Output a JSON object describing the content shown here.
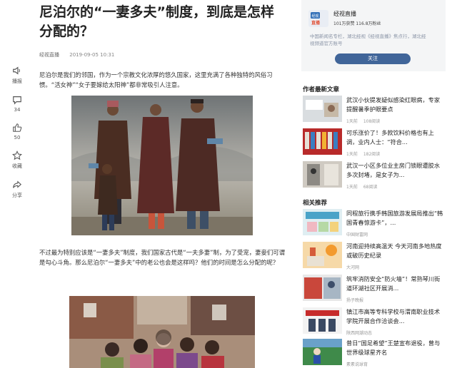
{
  "article": {
    "title": "尼泊尔的“一妻多夫”制度，到底是怎样分配的？",
    "source": "经视直播",
    "date": "2019-09-05 10:31",
    "paragraph1": "尼泊尔是我们的邻国，作为一个宗教文化浓厚的悠久国家，这里充满了各种独特的风俗习惯。“活女神”“女子要嫁给太阳神”都非常吸引人注意。",
    "paragraph2": "不过最为特别应该是“一妻多夫”制度，我们国家古代是“一夫多妻”制，为了受宠，妻妾们可谓是勾心斗角。那么尼泊尔“一妻多夫”中的老公也会是这样吗？他们的时间是怎么分配的呢？"
  },
  "rail": [
    {
      "label": "播报",
      "icon": "speaker-icon"
    },
    {
      "label": "34",
      "icon": "comment-icon"
    },
    {
      "label": "50",
      "icon": "thumbs-up-icon"
    },
    {
      "label": "收藏",
      "icon": "star-icon"
    },
    {
      "label": "分享",
      "icon": "share-icon"
    }
  ],
  "author": {
    "logo_text": "经视直播",
    "name": "经视直播",
    "stats": "101万获赞 116.8万粉丝",
    "desc": "中国新闻名专栏，湖北经视《经视直播》焦点行，湖北经视频道官方账号",
    "follow": "关注"
  },
  "author_articles": {
    "title": "作者最新文章",
    "items": [
      {
        "title": "武汉小伙提发疑似感染红眼病，专家提醒暑季护眼要点",
        "time": "1天前",
        "reads": "108阅读"
      },
      {
        "title": "可乐涨价了！多款饮料价格也有上调，业内人士：“符合...",
        "time": "1天前",
        "reads": "182阅读"
      },
      {
        "title": "武汉一小区多位业主房门锁眼遭胶水多次封堵，是女子为...",
        "time": "1天前",
        "reads": "68阅读"
      }
    ]
  },
  "recommend": {
    "title": "相关推荐",
    "items": [
      {
        "title": "同程旅行携手韩国旅游发展局推出“韩国青春惊游卡”，...",
        "source": "中国财富网"
      },
      {
        "title": "河南迎持续高温天 今天河南多地热度或破历史纪录",
        "source": "大河网"
      },
      {
        "title": "筑牢消防安全“防火墙”！常熟琴川街道环湖社区开展消...",
        "source": "扬子晚报"
      },
      {
        "title": "镇江市高等专科学校与渭南职业技术学院开展合作洽谈会...",
        "source": "陕西网潮动态"
      },
      {
        "title": "昔日“国足希望”王楚宣布退役，曾与世界级球星齐名",
        "source": "素素说球育"
      }
    ]
  }
}
